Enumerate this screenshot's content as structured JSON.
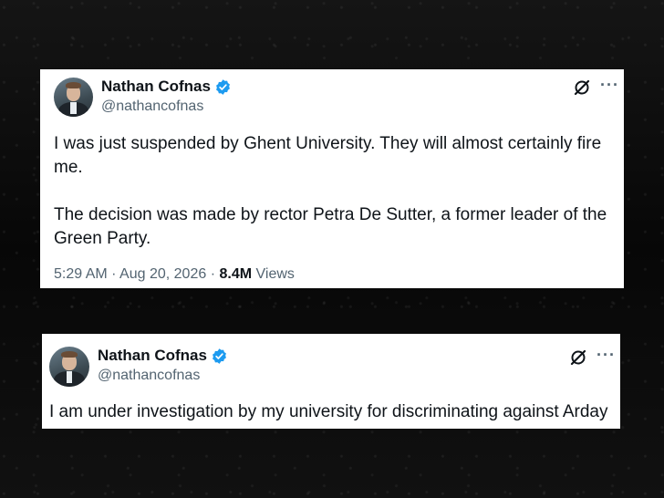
{
  "tweets": [
    {
      "name": "Nathan Cofnas",
      "handle": "@nathancofnas",
      "paragraphs": [
        "I was just suspended by Ghent University. They will almost certainly fire me.",
        "The decision was made by rector Petra De Sutter, a former leader of the Green Party."
      ],
      "time": "5:29 AM",
      "date": "Aug 20, 2026",
      "views_count": "8.4M",
      "views_label": "Views",
      "more_label": "···",
      "icons": [
        "avatar",
        "verified-badge-icon",
        "grok-icon",
        "more-icon"
      ]
    },
    {
      "name": "Nathan Cofnas",
      "handle": "@nathancofnas",
      "text": "I am under investigation by my university for discriminating against Arday",
      "more_label": "···",
      "icons": [
        "avatar",
        "verified-badge-icon",
        "grok-icon",
        "more-icon"
      ]
    }
  ],
  "colors": {
    "background": "#0b0b0b",
    "card": "#ffffff",
    "text_primary": "#0f1419",
    "text_secondary": "#536471",
    "verified": "#1d9bf0"
  }
}
